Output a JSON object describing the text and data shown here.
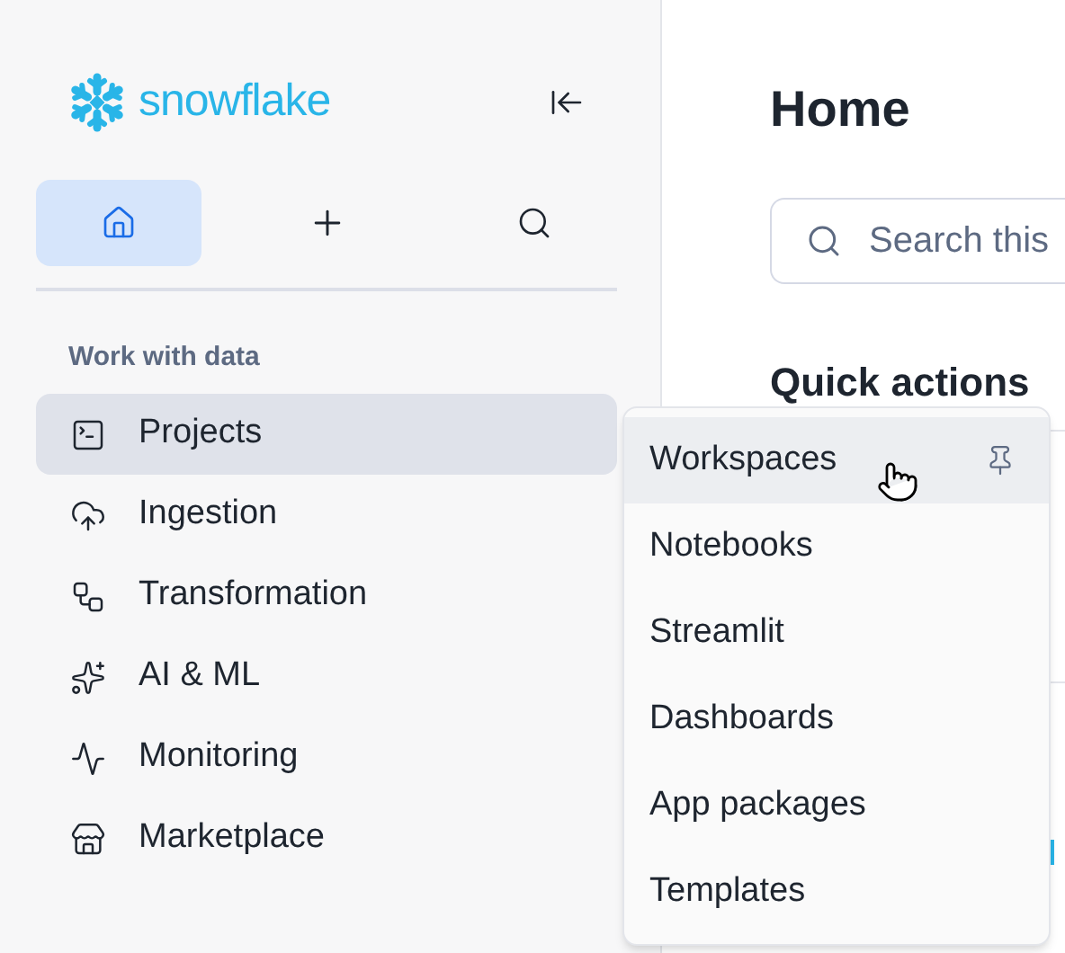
{
  "brand": {
    "name": "snowflake"
  },
  "toolbar": [
    {
      "kind": "home",
      "selected": true
    },
    {
      "kind": "add",
      "selected": false
    },
    {
      "kind": "search",
      "selected": false
    }
  ],
  "sidebar": {
    "section": "Work with data",
    "items": [
      {
        "label": "Projects",
        "selected": true
      },
      {
        "label": "Ingestion",
        "selected": false
      },
      {
        "label": "Transformation",
        "selected": false
      },
      {
        "label": "AI & ML",
        "selected": false
      },
      {
        "label": "Monitoring",
        "selected": false
      },
      {
        "label": "Marketplace",
        "selected": false
      }
    ]
  },
  "main": {
    "title": "Home",
    "search": {
      "placeholder": "Search this"
    },
    "quick_actions": "Quick actions"
  },
  "menu": {
    "items": [
      {
        "label": "Workspaces",
        "hovered": true
      },
      {
        "label": "Notebooks",
        "hovered": false
      },
      {
        "label": "Streamlit",
        "hovered": false
      },
      {
        "label": "Dashboards",
        "hovered": false
      },
      {
        "label": "App packages",
        "hovered": false
      },
      {
        "label": "Templates",
        "hovered": false
      }
    ]
  }
}
